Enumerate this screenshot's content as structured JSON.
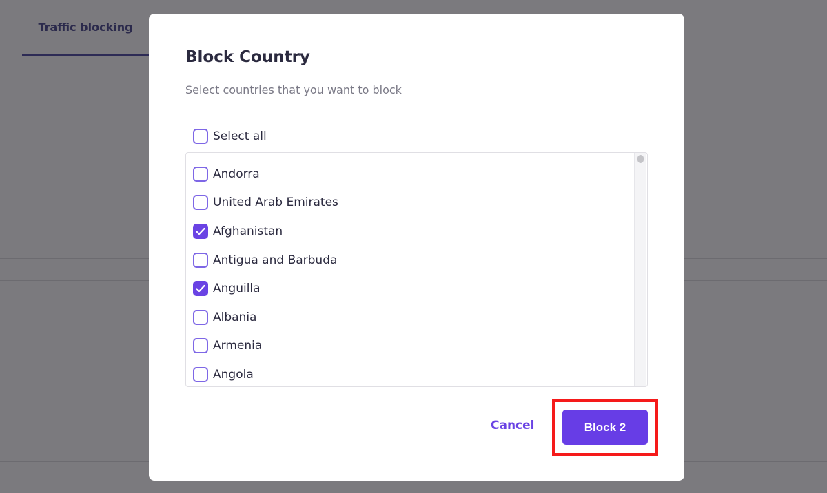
{
  "background": {
    "tab_label": "Traffic blocking"
  },
  "modal": {
    "title": "Block Country",
    "subtitle": "Select countries that you want to block",
    "select_all": {
      "label": "Select all",
      "checked": false
    },
    "countries": [
      {
        "label": "Andorra",
        "checked": false
      },
      {
        "label": "United Arab Emirates",
        "checked": false
      },
      {
        "label": "Afghanistan",
        "checked": true
      },
      {
        "label": "Antigua and Barbuda",
        "checked": false
      },
      {
        "label": "Anguilla",
        "checked": true
      },
      {
        "label": "Albania",
        "checked": false
      },
      {
        "label": "Armenia",
        "checked": false
      },
      {
        "label": "Angola",
        "checked": false
      }
    ],
    "cancel_label": "Cancel",
    "block_label": "Block 2"
  },
  "colors": {
    "accent": "#673de6",
    "highlight": "#f51a1a",
    "overlay": "#7b7a7e"
  }
}
